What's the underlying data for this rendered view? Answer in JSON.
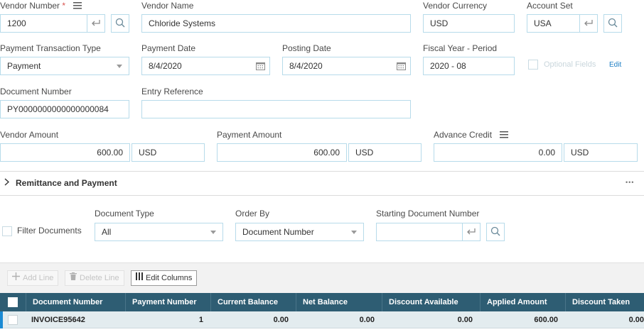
{
  "header": {
    "vendor_number_label": "Vendor Number",
    "required_mark": "*",
    "vendor_number_value": "1200",
    "vendor_name_label": "Vendor Name",
    "vendor_name_value": "Chloride Systems",
    "vendor_currency_label": "Vendor Currency",
    "vendor_currency_value": "USD",
    "account_set_label": "Account Set",
    "account_set_value": "USA",
    "payment_type_label": "Payment Transaction Type",
    "payment_type_value": "Payment",
    "payment_date_label": "Payment Date",
    "payment_date_value": "8/4/2020",
    "posting_date_label": "Posting Date",
    "posting_date_value": "8/4/2020",
    "fiscal_label": "Fiscal Year - Period",
    "fiscal_value": "2020 - 08",
    "optional_fields_label": "Optional Fields",
    "optional_fields_edit": "Edit",
    "document_number_label": "Document Number",
    "document_number_value": "PY0000000000000000084",
    "entry_reference_label": "Entry Reference",
    "entry_reference_value": ""
  },
  "amounts": {
    "vendor_amount_label": "Vendor Amount",
    "vendor_amount_value": "600.00",
    "vendor_amount_currency": "USD",
    "payment_amount_label": "Payment Amount",
    "payment_amount_value": "600.00",
    "payment_amount_currency": "USD",
    "advance_credit_label": "Advance Credit",
    "advance_credit_value": "0.00",
    "advance_credit_currency": "USD"
  },
  "section": {
    "title": "Remittance and Payment",
    "more_glyph": "•••"
  },
  "filter": {
    "filter_documents_label": "Filter Documents",
    "document_type_label": "Document Type",
    "document_type_value": "All",
    "order_by_label": "Order By",
    "order_by_value": "Document Number",
    "starting_doc_label": "Starting Document Number",
    "starting_doc_value": ""
  },
  "toolbar": {
    "add_line": "Add Line",
    "delete_line": "Delete Line",
    "edit_columns": "Edit Columns"
  },
  "grid": {
    "columns": [
      "Document Number",
      "Payment Number",
      "Current Balance",
      "Net Balance",
      "Discount Available",
      "Applied Amount",
      "Discount Taken"
    ],
    "rows": [
      [
        "INVOICE95642",
        "1",
        "0.00",
        "0.00",
        "0.00",
        "600.00",
        "0.00"
      ]
    ]
  },
  "colors": {
    "accent": "#2e5d73",
    "field_border": "#b7dbea",
    "link": "#1a7dc4",
    "row_indicator": "#1a8ad4"
  }
}
